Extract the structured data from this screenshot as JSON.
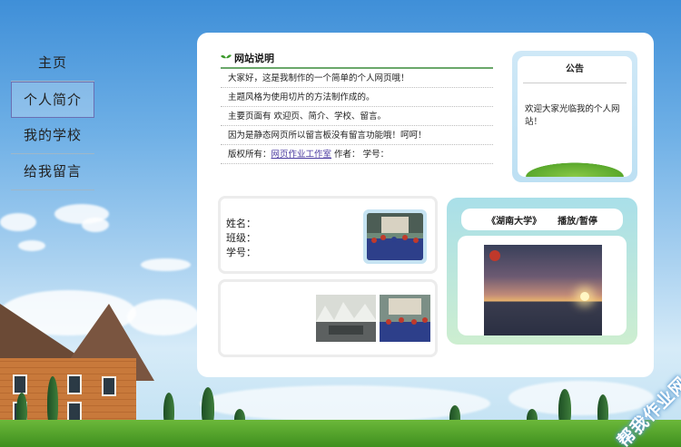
{
  "nav": {
    "items": [
      {
        "label": "主页"
      },
      {
        "label": "个人简介"
      },
      {
        "label": "我的学校"
      },
      {
        "label": "给我留言"
      }
    ],
    "active_index": 1
  },
  "site_description": {
    "title": "网站说明",
    "lines": [
      "大家好，这是我制作的一个简单的个人网页哦！",
      "主题风格为使用切片的方法制作成的。",
      "主要页面有 欢迎页、简介、学校、留言。",
      "因为是静态网页所以留言板没有留言功能哦！呵呵！"
    ],
    "copyright_prefix": "版权所有：",
    "copyright_link": "网页作业工作室",
    "author_label": " 作者：",
    "student_id_label": " 学号："
  },
  "notice": {
    "title": "公告",
    "text": "欢迎大家光临我的个人网站！"
  },
  "profile": {
    "name_label": "姓名：",
    "class_label": "班级：",
    "id_label": "学号："
  },
  "video": {
    "title": "《湖南大学》",
    "control_label": "播放/暂停"
  },
  "watermark": "帮我作业网",
  "colors": {
    "accent_green": "#6aa76a",
    "link": "#4a3aa0",
    "nav_active_border": "#6a6fb3"
  }
}
